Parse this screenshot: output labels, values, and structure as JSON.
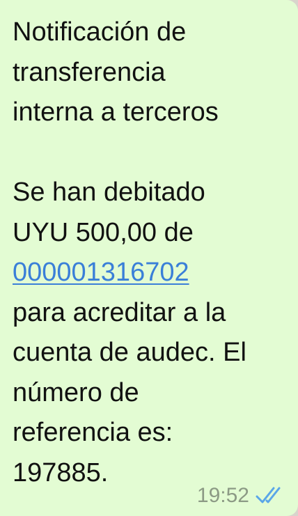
{
  "message": {
    "title_lines": [
      "Notificación de",
      "transferencia",
      "interna a terceros"
    ],
    "body_line_1": "Se han debitado",
    "body_line_2": "UYU 500,00 de",
    "account_link": "000001316702",
    "body_rest_lines": [
      "para acreditar a la",
      "cuenta de audec. El",
      "número de",
      "referencia es:",
      "197885."
    ]
  },
  "meta": {
    "time": "19:52",
    "status_icon": "double-check-read-icon",
    "tick_color": "#5aa6e8"
  },
  "colors": {
    "bubble_bg": "#e3fcd3",
    "text": "#111111",
    "link": "#3a7fd8",
    "time": "#8c9a85"
  }
}
